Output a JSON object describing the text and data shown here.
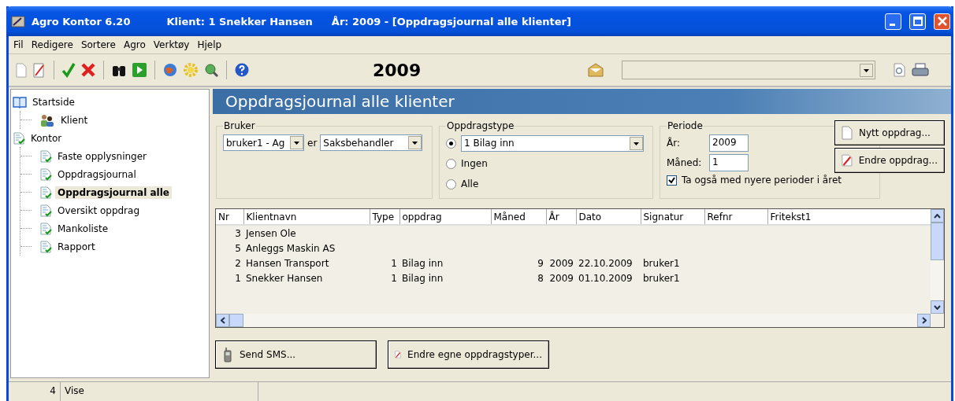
{
  "window": {
    "app": "Agro Kontor 6.20",
    "client": "Klient:  1  Snekker Hansen",
    "year": "År: 2009 - [Oppdragsjournal alle klienter]"
  },
  "menu": [
    "Fil",
    "Redigere",
    "Sortere",
    "Agro",
    "Verktøy",
    "Hjelp"
  ],
  "toolbar": {
    "year": "2009"
  },
  "sidebar": {
    "items": [
      {
        "label": "Startside",
        "kind": "book",
        "selected": false,
        "children": [
          {
            "label": "Klient",
            "kind": "people",
            "selected": false
          }
        ]
      },
      {
        "label": "Kontor",
        "kind": "doc",
        "selected": false,
        "children": [
          {
            "label": "Faste opplysninger",
            "kind": "doc",
            "selected": false
          },
          {
            "label": "Oppdragsjournal",
            "kind": "doc",
            "selected": false
          },
          {
            "label": "Oppdragsjournal alle",
            "kind": "doc",
            "selected": true
          },
          {
            "label": "Oversikt oppdrag",
            "kind": "doc",
            "selected": false
          },
          {
            "label": "Mankoliste",
            "kind": "doc",
            "selected": false
          },
          {
            "label": "Rapport",
            "kind": "doc",
            "selected": false
          }
        ]
      }
    ]
  },
  "panel": {
    "title": "Oppdragsjournal alle klienter"
  },
  "bruker": {
    "legend": "Bruker",
    "user": "bruker1 - Ag",
    "connector": "er",
    "role": "Saksbehandler"
  },
  "oppdragstype": {
    "legend": "Oppdragstype",
    "options": [
      {
        "label": "1 Bilag inn",
        "kind": "dropdown",
        "selected": true
      },
      {
        "label": "Ingen",
        "kind": "plain",
        "selected": false
      },
      {
        "label": "Alle",
        "kind": "plain",
        "selected": false
      }
    ]
  },
  "periode": {
    "legend": "Periode",
    "year_label": "År:",
    "year": "2009",
    "month_label": "Måned:",
    "month": "1",
    "checkbox": {
      "label": "Ta også med nyere perioder i året",
      "checked": true
    }
  },
  "actions": [
    {
      "label": "Nytt oppdrag...",
      "kind": "new"
    },
    {
      "label": "Endre oppdrag...",
      "kind": "edit"
    }
  ],
  "table": {
    "columns": [
      "Nr",
      "Klientnavn",
      "Type",
      "oppdrag",
      "Måned",
      "År",
      "Dato",
      "Signatur",
      "Refnr",
      "Fritekst1"
    ],
    "rows": [
      {
        "nr": "3",
        "client": "Jensen Ole"
      },
      {
        "nr": "5",
        "client": "Anleggs Maskin AS"
      },
      {
        "nr": "2",
        "client": "Hansen Transport",
        "type": "1",
        "assignment": "Bilag inn",
        "month": "9",
        "year": "2009",
        "date": "22.10.2009",
        "signature": "bruker1"
      },
      {
        "nr": "1",
        "client": "Snekker Hansen",
        "type": "1",
        "assignment": "Bilag inn",
        "month": "8",
        "year": "2009",
        "date": "01.10.2009",
        "signature": "bruker1"
      }
    ]
  },
  "bottom_buttons": [
    {
      "label": "Send SMS...",
      "kind": "phone"
    },
    {
      "label": "Endre egne oppdragstyper...",
      "kind": "edit"
    }
  ],
  "status_bar": {
    "count": "4",
    "mode": "Vise"
  }
}
